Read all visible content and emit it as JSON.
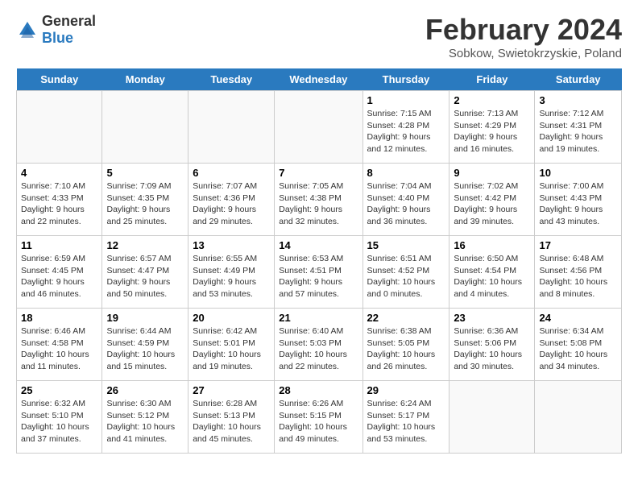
{
  "header": {
    "logo_general": "General",
    "logo_blue": "Blue",
    "title": "February 2024",
    "subtitle": "Sobkow, Swietokrzyskie, Poland"
  },
  "days": [
    "Sunday",
    "Monday",
    "Tuesday",
    "Wednesday",
    "Thursday",
    "Friday",
    "Saturday"
  ],
  "weeks": [
    [
      {
        "date": "",
        "content": ""
      },
      {
        "date": "",
        "content": ""
      },
      {
        "date": "",
        "content": ""
      },
      {
        "date": "",
        "content": ""
      },
      {
        "date": "1",
        "content": "Sunrise: 7:15 AM\nSunset: 4:28 PM\nDaylight: 9 hours\nand 12 minutes."
      },
      {
        "date": "2",
        "content": "Sunrise: 7:13 AM\nSunset: 4:29 PM\nDaylight: 9 hours\nand 16 minutes."
      },
      {
        "date": "3",
        "content": "Sunrise: 7:12 AM\nSunset: 4:31 PM\nDaylight: 9 hours\nand 19 minutes."
      }
    ],
    [
      {
        "date": "4",
        "content": "Sunrise: 7:10 AM\nSunset: 4:33 PM\nDaylight: 9 hours\nand 22 minutes."
      },
      {
        "date": "5",
        "content": "Sunrise: 7:09 AM\nSunset: 4:35 PM\nDaylight: 9 hours\nand 25 minutes."
      },
      {
        "date": "6",
        "content": "Sunrise: 7:07 AM\nSunset: 4:36 PM\nDaylight: 9 hours\nand 29 minutes."
      },
      {
        "date": "7",
        "content": "Sunrise: 7:05 AM\nSunset: 4:38 PM\nDaylight: 9 hours\nand 32 minutes."
      },
      {
        "date": "8",
        "content": "Sunrise: 7:04 AM\nSunset: 4:40 PM\nDaylight: 9 hours\nand 36 minutes."
      },
      {
        "date": "9",
        "content": "Sunrise: 7:02 AM\nSunset: 4:42 PM\nDaylight: 9 hours\nand 39 minutes."
      },
      {
        "date": "10",
        "content": "Sunrise: 7:00 AM\nSunset: 4:43 PM\nDaylight: 9 hours\nand 43 minutes."
      }
    ],
    [
      {
        "date": "11",
        "content": "Sunrise: 6:59 AM\nSunset: 4:45 PM\nDaylight: 9 hours\nand 46 minutes."
      },
      {
        "date": "12",
        "content": "Sunrise: 6:57 AM\nSunset: 4:47 PM\nDaylight: 9 hours\nand 50 minutes."
      },
      {
        "date": "13",
        "content": "Sunrise: 6:55 AM\nSunset: 4:49 PM\nDaylight: 9 hours\nand 53 minutes."
      },
      {
        "date": "14",
        "content": "Sunrise: 6:53 AM\nSunset: 4:51 PM\nDaylight: 9 hours\nand 57 minutes."
      },
      {
        "date": "15",
        "content": "Sunrise: 6:51 AM\nSunset: 4:52 PM\nDaylight: 10 hours\nand 0 minutes."
      },
      {
        "date": "16",
        "content": "Sunrise: 6:50 AM\nSunset: 4:54 PM\nDaylight: 10 hours\nand 4 minutes."
      },
      {
        "date": "17",
        "content": "Sunrise: 6:48 AM\nSunset: 4:56 PM\nDaylight: 10 hours\nand 8 minutes."
      }
    ],
    [
      {
        "date": "18",
        "content": "Sunrise: 6:46 AM\nSunset: 4:58 PM\nDaylight: 10 hours\nand 11 minutes."
      },
      {
        "date": "19",
        "content": "Sunrise: 6:44 AM\nSunset: 4:59 PM\nDaylight: 10 hours\nand 15 minutes."
      },
      {
        "date": "20",
        "content": "Sunrise: 6:42 AM\nSunset: 5:01 PM\nDaylight: 10 hours\nand 19 minutes."
      },
      {
        "date": "21",
        "content": "Sunrise: 6:40 AM\nSunset: 5:03 PM\nDaylight: 10 hours\nand 22 minutes."
      },
      {
        "date": "22",
        "content": "Sunrise: 6:38 AM\nSunset: 5:05 PM\nDaylight: 10 hours\nand 26 minutes."
      },
      {
        "date": "23",
        "content": "Sunrise: 6:36 AM\nSunset: 5:06 PM\nDaylight: 10 hours\nand 30 minutes."
      },
      {
        "date": "24",
        "content": "Sunrise: 6:34 AM\nSunset: 5:08 PM\nDaylight: 10 hours\nand 34 minutes."
      }
    ],
    [
      {
        "date": "25",
        "content": "Sunrise: 6:32 AM\nSunset: 5:10 PM\nDaylight: 10 hours\nand 37 minutes."
      },
      {
        "date": "26",
        "content": "Sunrise: 6:30 AM\nSunset: 5:12 PM\nDaylight: 10 hours\nand 41 minutes."
      },
      {
        "date": "27",
        "content": "Sunrise: 6:28 AM\nSunset: 5:13 PM\nDaylight: 10 hours\nand 45 minutes."
      },
      {
        "date": "28",
        "content": "Sunrise: 6:26 AM\nSunset: 5:15 PM\nDaylight: 10 hours\nand 49 minutes."
      },
      {
        "date": "29",
        "content": "Sunrise: 6:24 AM\nSunset: 5:17 PM\nDaylight: 10 hours\nand 53 minutes."
      },
      {
        "date": "",
        "content": ""
      },
      {
        "date": "",
        "content": ""
      }
    ]
  ]
}
